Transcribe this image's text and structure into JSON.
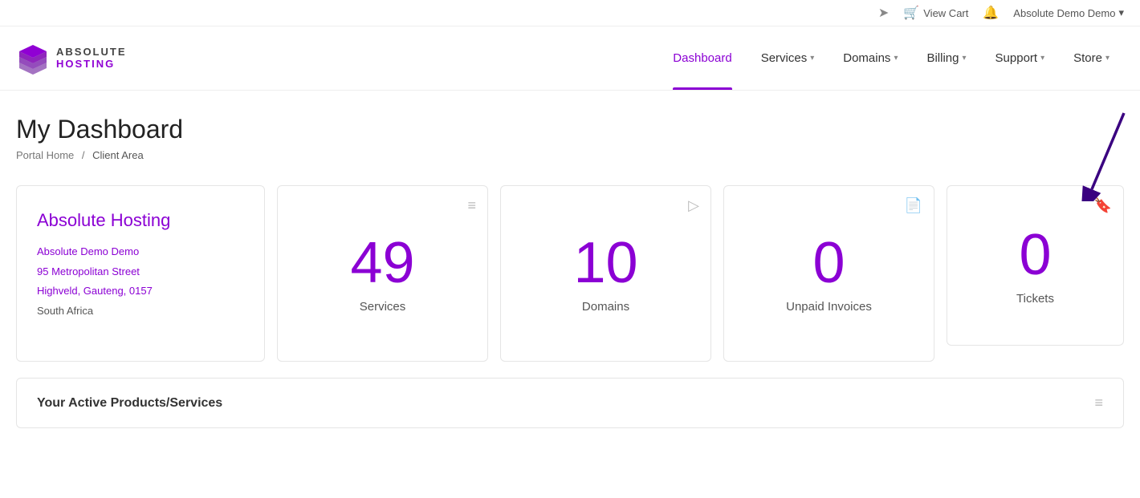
{
  "topbar": {
    "share_icon": "➤",
    "cart_icon": "🔔",
    "cart_label": "View Cart",
    "notification_icon": "🔔",
    "user_name": "Absolute Demo Demo",
    "user_chevron": "▾"
  },
  "navbar": {
    "logo_text_top": "ABSOLUTE",
    "logo_text_bottom": "HOSTING",
    "nav_items": [
      {
        "label": "Dashboard",
        "active": true,
        "has_chevron": false
      },
      {
        "label": "Services",
        "active": false,
        "has_chevron": true
      },
      {
        "label": "Domains",
        "active": false,
        "has_chevron": true
      },
      {
        "label": "Billing",
        "active": false,
        "has_chevron": true
      },
      {
        "label": "Support",
        "active": false,
        "has_chevron": true
      },
      {
        "label": "Store",
        "active": false,
        "has_chevron": true
      }
    ]
  },
  "page": {
    "title": "My Dashboard",
    "breadcrumb_home": "Portal Home",
    "breadcrumb_current": "Client Area"
  },
  "account_card": {
    "title": "Absolute Hosting",
    "name": "Absolute Demo Demo",
    "address": "95 Metropolitan Street",
    "region": "Highveld, Gauteng, 0157",
    "country": "South Africa"
  },
  "stats": [
    {
      "icon": "≡",
      "number": "49",
      "label": "Services"
    },
    {
      "icon": "▷",
      "number": "10",
      "label": "Domains"
    },
    {
      "icon": "📄",
      "number": "0",
      "label": "Unpaid Invoices"
    },
    {
      "icon": "🔖",
      "number": "0",
      "label": "Tickets"
    }
  ],
  "active_products": {
    "title": "Your Active Products/Services",
    "icon": "≡"
  }
}
